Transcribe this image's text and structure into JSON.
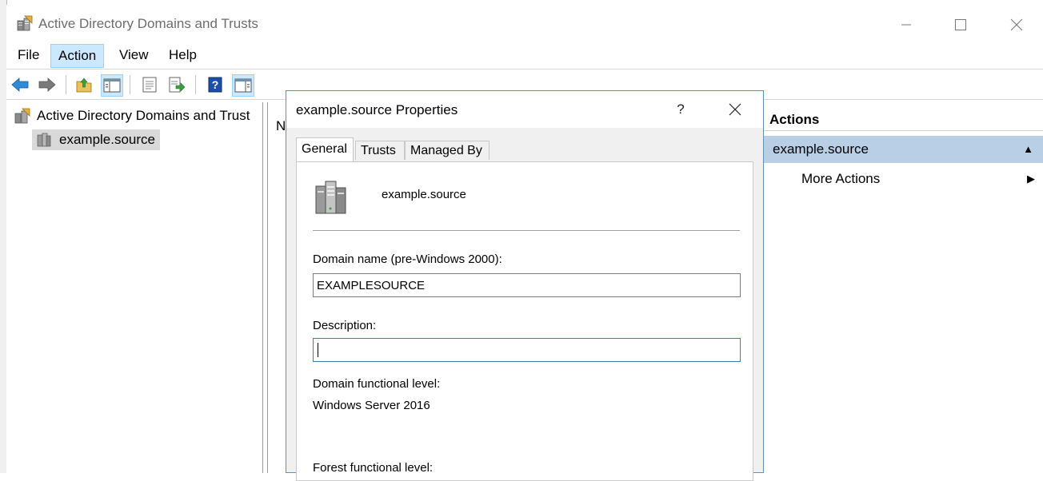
{
  "window": {
    "title": "Active Directory Domains and Trusts"
  },
  "menu": {
    "items": [
      "File",
      "Action",
      "View",
      "Help"
    ],
    "active": "Action"
  },
  "tree": {
    "root_label": "Active Directory Domains and Trust",
    "child_label": "example.source"
  },
  "middle_pane": {
    "header_fragment": "N"
  },
  "actions_pane": {
    "header": "Actions",
    "selected_item": "example.source",
    "more_actions": "More Actions"
  },
  "dialog": {
    "title": "example.source Properties",
    "help_label": "?",
    "tabs": [
      "General",
      "Trusts",
      "Managed By"
    ],
    "active_tab": "General",
    "domain_heading": "example.source",
    "domain_name_label": "Domain name (pre-Windows 2000):",
    "domain_name_value": "EXAMPLESOURCE",
    "description_label": "Description:",
    "description_value": "",
    "domain_level_label": "Domain functional level:",
    "domain_level_value": "Windows Server 2016",
    "forest_level_label": "Forest functional level:"
  },
  "icons": {
    "back": "back-arrow-icon",
    "forward": "forward-arrow-icon",
    "up": "up-folder-icon",
    "show_tree": "show-console-tree-icon",
    "properties": "properties-icon",
    "export": "export-list-icon",
    "help": "help-icon",
    "show_action_pane": "show-action-pane-icon"
  },
  "colors": {
    "menu_highlight": "#cce8ff",
    "actions_selected": "#b8cfe5",
    "dialog_border": "#5a93b5",
    "focus_border": "#3c7fb1"
  }
}
